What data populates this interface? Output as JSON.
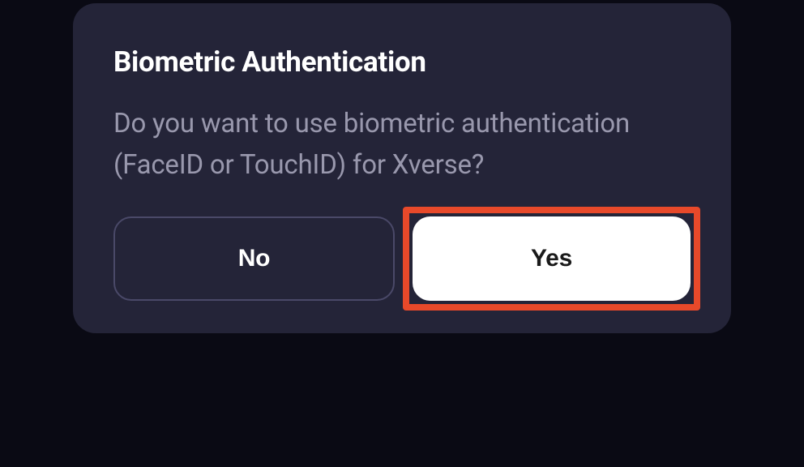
{
  "dialog": {
    "title": "Biometric Authentication",
    "message": "Do you want to use biometric authentication (FaceID or TouchID) for Xverse?",
    "buttons": {
      "no": "No",
      "yes": "Yes"
    }
  }
}
